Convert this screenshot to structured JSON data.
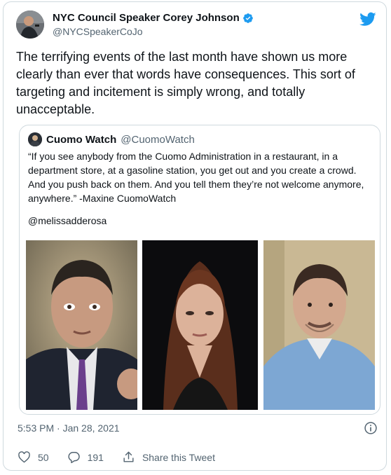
{
  "author": {
    "name": "NYC Council Speaker Corey Johnson",
    "handle": "@NYCSpeakerCoJo"
  },
  "tweet_text": "The terrifying events of the last month have shown us more clearly than ever that words have consequences. This sort of targeting and incitement is simply wrong, and totally unacceptable.",
  "quoted": {
    "name": "Cuomo Watch",
    "handle": "@CuomoWatch",
    "text": "“If you see anybody from the Cuomo Administration in a restaurant, in a department store, at a gasoline station, you get out and you create a crowd. And you push back on them. And you tell them they’re not welcome anymore, anywhere.” -Maxine CuomoWatch",
    "mention": "@melissadderosa"
  },
  "timestamp": "5:53 PM · Jan 28, 2021",
  "actions": {
    "likes": "50",
    "replies": "191",
    "share_label": "Share this Tweet"
  },
  "colors": {
    "verified": "#1d9bf0",
    "twitter_brand": "#1d9bf0",
    "text_primary": "#0f1419",
    "text_secondary": "#536471",
    "border": "#cfd9de"
  },
  "icons": [
    "verified-badge-icon",
    "twitter-logo-icon",
    "info-icon",
    "heart-icon",
    "reply-icon",
    "share-icon"
  ]
}
